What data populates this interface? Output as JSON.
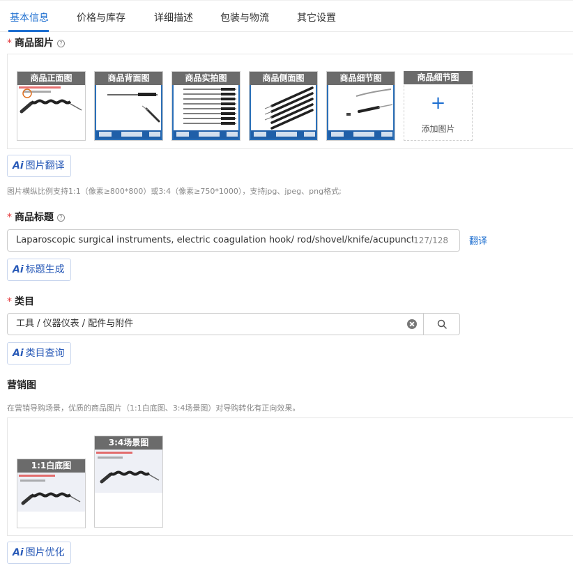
{
  "tabs": [
    {
      "label": "基本信息",
      "active": true
    },
    {
      "label": "价格与库存",
      "active": false
    },
    {
      "label": "详细描述",
      "active": false
    },
    {
      "label": "包装与物流",
      "active": false
    },
    {
      "label": "其它设置",
      "active": false
    }
  ],
  "images_section": {
    "required_mark": "*",
    "title": "商品图片",
    "help_icon": "question-circle-icon",
    "thumbnails": [
      {
        "label": "商品正面图"
      },
      {
        "label": "商品背面图"
      },
      {
        "label": "商品实拍图"
      },
      {
        "label": "商品侧面图"
      },
      {
        "label": "商品细节图"
      }
    ],
    "add_slot": {
      "label": "商品细节图",
      "plus": "+",
      "action": "添加图片"
    },
    "ai_button": "图片翻译",
    "hint": "图片横纵比例支持1:1（像素≥800*800）或3:4（像素≥750*1000），支持jpg、jpeg、png格式;"
  },
  "title_section": {
    "required_mark": "*",
    "title": "商品标题",
    "value": "Laparoscopic surgical instruments, electric coagulation hook/ rod/shovel/knife/acupuncture",
    "counter": "127/128",
    "translate_link": "翻译",
    "ai_button": "标题生成"
  },
  "category_section": {
    "required_mark": "*",
    "title": "类目",
    "value": "工具 / 仪器仪表 / 配件与附件",
    "ai_button": "类目查询"
  },
  "marketing_section": {
    "title": "营销图",
    "hint": "在营销导购场景，优质的商品图片（1:1白底图、3:4场景图）对导购转化有正向效果。",
    "images": [
      {
        "label": "1:1白底图"
      },
      {
        "label": "3:4场景图"
      }
    ],
    "ai_button": "图片优化"
  },
  "ai_icon_text": "Ai",
  "colors": {
    "accent": "#1e6fd0",
    "required": "#e4393c",
    "thumb_header": "#6b6b6b",
    "thumb_frame": "#2a6fb8"
  }
}
